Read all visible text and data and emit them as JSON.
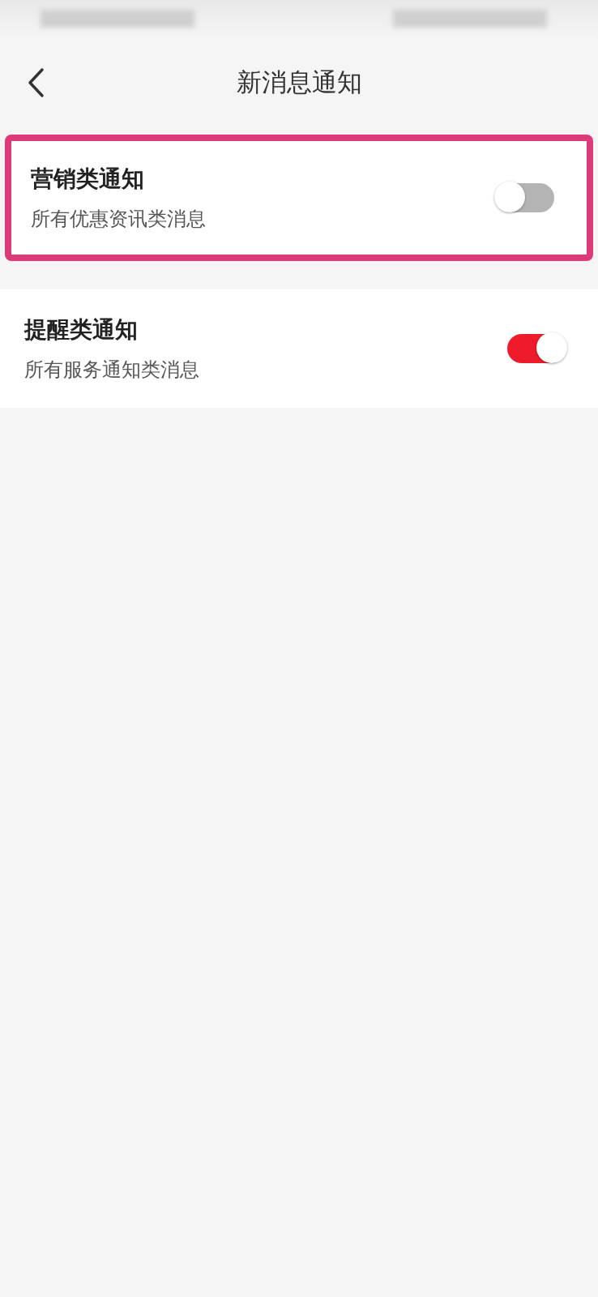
{
  "header": {
    "title": "新消息通知"
  },
  "settings": [
    {
      "title": "营销类通知",
      "subtitle": "所有优惠资讯类消息",
      "on": false,
      "highlighted": true
    },
    {
      "title": "提醒类通知",
      "subtitle": "所有服务通知类消息",
      "on": true,
      "highlighted": false
    }
  ]
}
